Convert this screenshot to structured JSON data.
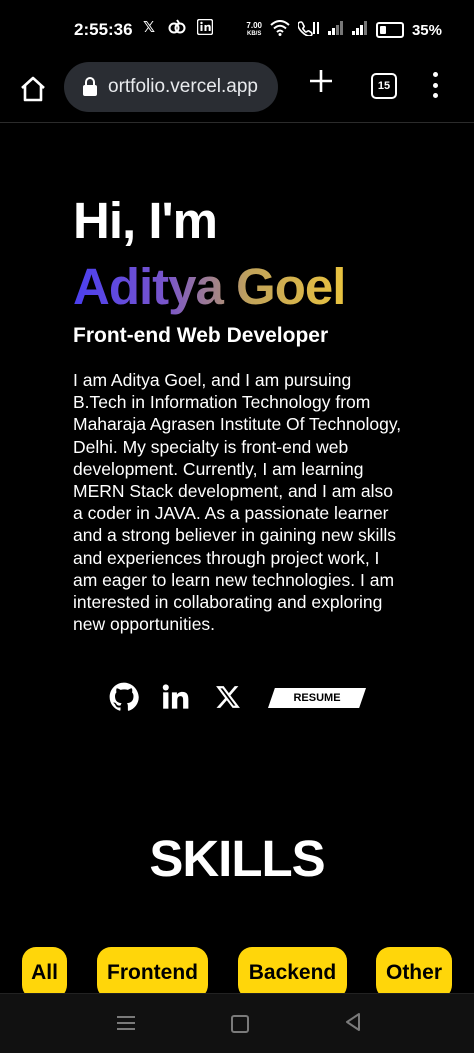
{
  "status_bar": {
    "time": "2:55:36",
    "netspeed_value": "7.00",
    "netspeed_unit": "KB/S",
    "battery": "35%"
  },
  "browser": {
    "url": "ortfolio.vercel.app",
    "tab_count": "15"
  },
  "hero": {
    "greeting": "Hi, I'm",
    "name": "Aditya Goel",
    "role": "Front-end Web Developer",
    "bio": "I am Aditya Goel, and I am pursuing B.Tech in Information Technology from Maharaja Agrasen Institute Of Technology, Delhi. My specialty is front-end web development. Currently, I am learning MERN Stack development, and I am also a coder in JAVA. As a passionate learner and a strong believer in gaining new skills and experiences through project work, I am eager to learn new technologies. I am interested in collaborating and exploring new opportunities.",
    "resume_label": "RESUME",
    "socials": [
      "github-icon",
      "linkedin-icon",
      "x-icon"
    ]
  },
  "skills": {
    "title": "SKILLS",
    "filters": [
      "All",
      "Frontend",
      "Backend",
      "Other"
    ]
  },
  "colors": {
    "accent_yellow": "#ffd60a",
    "gradient_start": "#4b3ff0",
    "gradient_end": "#e9c33f",
    "background": "#000000"
  }
}
